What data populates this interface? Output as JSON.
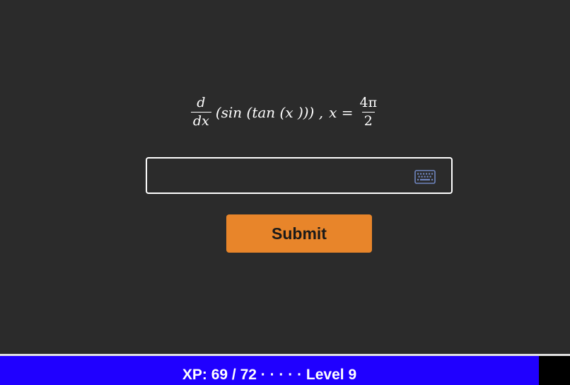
{
  "problem": {
    "derivative_numerator": "d",
    "derivative_denominator": "dx",
    "function_expression": "(sin (tan (x ))) ,",
    "variable_assignment": "x =",
    "value_numerator": "4π",
    "value_denominator": "2"
  },
  "answer": {
    "value": "",
    "placeholder": ""
  },
  "keyboard_icon": "keyboard-icon",
  "submit": {
    "label": "Submit"
  },
  "footer": {
    "xp_label": "XP: 69 / 72",
    "separator": "· · · · ·",
    "level_label": "Level 9"
  },
  "colors": {
    "background": "#2b2b2b",
    "submit_button": "#e8852a",
    "footer_bar": "#2000ff",
    "keyboard_icon": "#6f86c0"
  }
}
